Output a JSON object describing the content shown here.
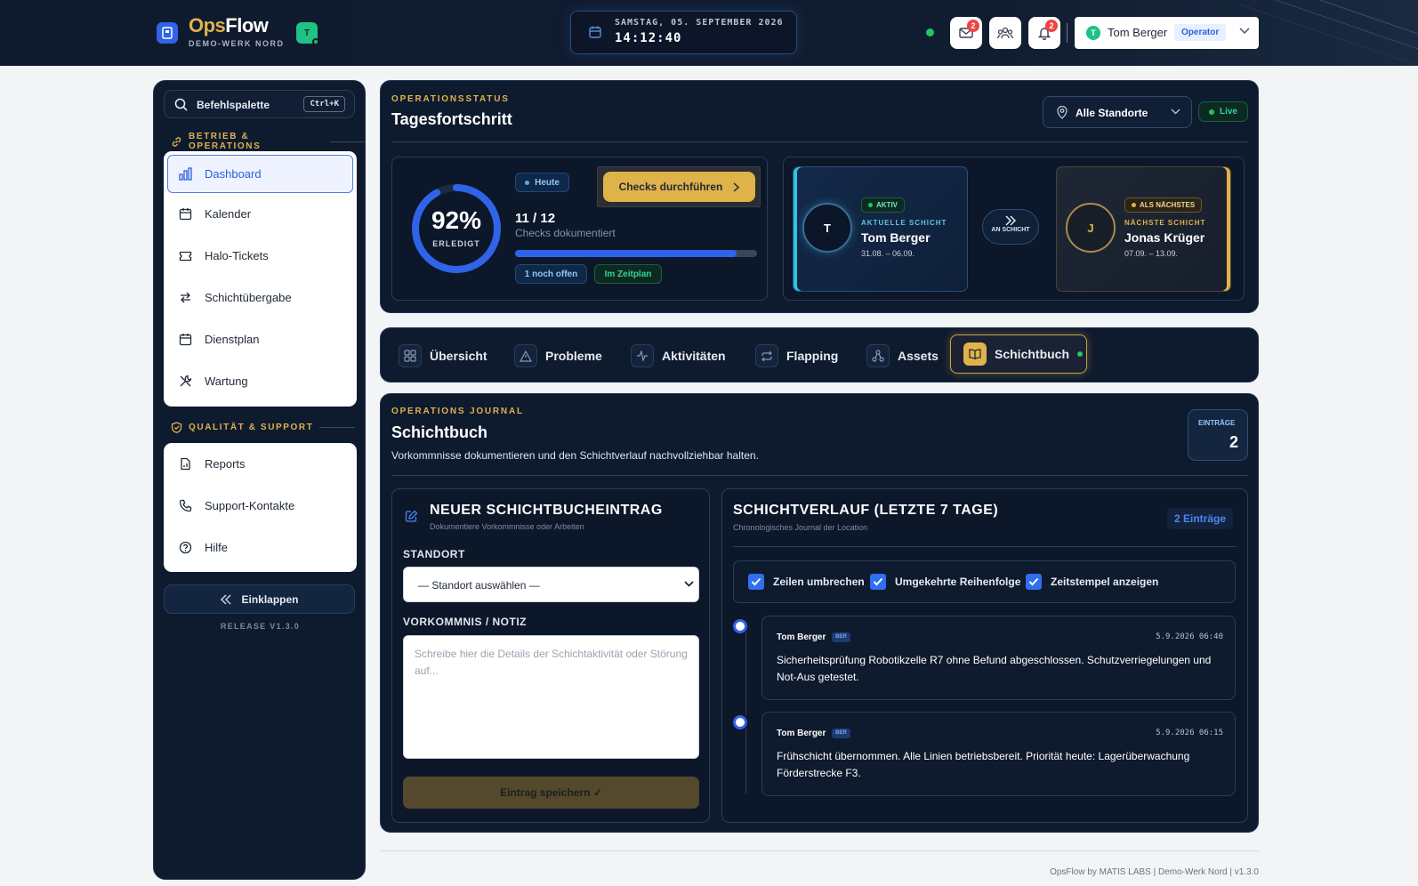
{
  "app": {
    "brand_ops": "Ops",
    "brand_flow": "Flow",
    "subtitle": "DEMO-WERK NORD",
    "workspace_badge": "T"
  },
  "clock": {
    "date": "SAMSTAG, 05. SEPTEMBER 2026",
    "time": "14:12:40"
  },
  "header": {
    "mail_count": "2",
    "alerts_count": "2",
    "user_initial": "T",
    "user_name": "Tom Berger",
    "user_role": "Operator"
  },
  "sidebar": {
    "command_label": "Befehlspalette",
    "command_shortcut": "Ctrl+K",
    "section_ops": "BETRIEB & OPERATIONS",
    "items_ops": [
      {
        "label": "Dashboard",
        "icon": "chart-bar-icon"
      },
      {
        "label": "Kalender",
        "icon": "calendar-icon"
      },
      {
        "label": "Halo-Tickets",
        "icon": "ticket-icon"
      },
      {
        "label": "Schichtübergabe",
        "icon": "swap-arrows-icon"
      },
      {
        "label": "Dienstplan",
        "icon": "calendar-icon"
      },
      {
        "label": "Wartung",
        "icon": "wrench-icon"
      }
    ],
    "section_quality": "QUALITÄT & SUPPORT",
    "items_quality": [
      {
        "label": "Reports",
        "icon": "report-icon"
      },
      {
        "label": "Support-Kontakte",
        "icon": "phone-icon"
      },
      {
        "label": "Hilfe",
        "icon": "help-icon"
      }
    ],
    "collapse_label": "Einklappen",
    "release": "RELEASE V1.3.0"
  },
  "status": {
    "eyebrow": "OPERATIONSSTATUS",
    "title": "Tagesfortschritt",
    "location_select": "Alle Standorte",
    "live_label": "Live",
    "percent_text": "92%",
    "percent_value": 0.92,
    "percent_label": "ERLEDIGT",
    "today_pill": "Heute",
    "checks_button": "Checks durchführen",
    "count_text": "11 / 12",
    "count_sub": "Checks dokumentiert",
    "progress_value": 0.917,
    "open_pill": "1 noch offen",
    "plan_pill": "Im Zeitplan"
  },
  "shifts": {
    "current": {
      "initial": "T",
      "tag": "AKTIV",
      "kind": "AKTUELLE SCHICHT",
      "name": "Tom Berger",
      "dates": "31.08. – 06.09."
    },
    "handover_label": "AN SCHICHT",
    "next": {
      "initial": "J",
      "tag": "ALS NÄCHSTES",
      "kind": "NÄCHSTE SCHICHT",
      "name": "Jonas Krüger",
      "dates": "07.09. – 13.09."
    }
  },
  "tabs": [
    {
      "label": "Übersicht",
      "icon": "grid-icon"
    },
    {
      "label": "Probleme",
      "icon": "warning-icon"
    },
    {
      "label": "Aktivitäten",
      "icon": "activity-icon"
    },
    {
      "label": "Flapping",
      "icon": "repeat-icon"
    },
    {
      "label": "Assets",
      "icon": "network-icon"
    },
    {
      "label": "Schichtbuch",
      "icon": "book-icon"
    }
  ],
  "journal": {
    "eyebrow": "OPERATIONS JOURNAL",
    "title": "Schichtbuch",
    "description": "Vorkommnisse dokumentieren und den Schichtverlauf nachvollziehbar halten.",
    "entries_label": "EINTRÄGE",
    "entries_count": "2",
    "new_entry": {
      "title": "NEUER SCHICHTBUCHEINTRAG",
      "subtitle": "Dokumentiere Vorkommnisse oder Arbeiten",
      "location_label": "STANDORT",
      "location_value": "— Standort auswählen —",
      "note_label": "VORKOMMNIS / NOTIZ",
      "note_placeholder": "Schreibe hier die Details der Schichtaktivität oder Störung auf...",
      "save_label": "Eintrag speichern ✓"
    },
    "history": {
      "title": "SCHICHTVERLAUF (LETZTE 7 TAGE)",
      "subtitle": "Chronologisches Journal der Location",
      "count_badge": "2 Einträge",
      "options": [
        {
          "label": "Zeilen umbrechen",
          "checked": true
        },
        {
          "label": "Umgekehrte Reihenfolge",
          "checked": true
        },
        {
          "label": "Zeitstempel anzeigen",
          "checked": true
        }
      ],
      "entries": [
        {
          "author": "Tom Berger",
          "location": "BER",
          "timestamp": "5.9.2026 06:40",
          "text": "Sicherheitsprüfung Robotikzelle R7 ohne Befund abgeschlossen. Schutzverriegelungen und Not-Aus getestet."
        },
        {
          "author": "Tom Berger",
          "location": "BER",
          "timestamp": "5.9.2026 06:15",
          "text": "Frühschicht übernommen. Alle Linien betriebsbereit. Priorität heute: Lagerüberwachung Förderstrecke F3."
        }
      ]
    }
  },
  "footer": "OpsFlow by MATIS LABS | Demo-Werk Nord | v1.3.0",
  "colors": {
    "accent_gold": "#e0b24a",
    "accent_blue": "#2f63e8",
    "panel_bg": "#0e1a2e",
    "live_green": "#22c55e"
  }
}
